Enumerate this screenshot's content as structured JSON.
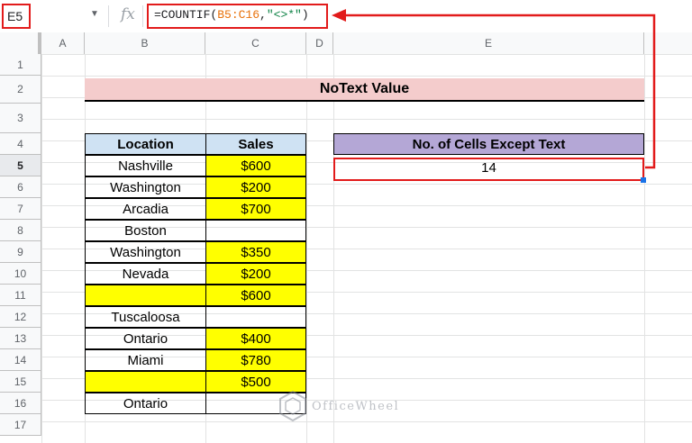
{
  "formula_bar": {
    "name_box": "E5",
    "fx": "fx",
    "formula_prefix": "=COUNTIF(",
    "formula_range": "B5:C16",
    "formula_sep": ",",
    "formula_criteria": "\"<>*\"",
    "formula_suffix": ")"
  },
  "columns": [
    "A",
    "B",
    "C",
    "D",
    "E"
  ],
  "rows": [
    "1",
    "2",
    "3",
    "4",
    "5",
    "6",
    "7",
    "8",
    "9",
    "10",
    "11",
    "12",
    "13",
    "14",
    "15",
    "16",
    "17"
  ],
  "selected_row": "5",
  "sheet": {
    "title": "NoText Value",
    "table": {
      "headers": [
        "Location",
        "Sales"
      ],
      "rows": [
        {
          "location": "Nashville",
          "sales": "$600"
        },
        {
          "location": "Washington",
          "sales": "$200"
        },
        {
          "location": "Arcadia",
          "sales": "$700"
        },
        {
          "location": "Boston",
          "sales": ""
        },
        {
          "location": "Washington",
          "sales": "$350"
        },
        {
          "location": "Nevada",
          "sales": "$200"
        },
        {
          "location": "",
          "sales": "$600"
        },
        {
          "location": "Tuscaloosa",
          "sales": ""
        },
        {
          "location": "Ontario",
          "sales": "$400"
        },
        {
          "location": "Miami",
          "sales": "$780"
        },
        {
          "location": "",
          "sales": "$500"
        },
        {
          "location": "Ontario",
          "sales": ""
        }
      ]
    },
    "result": {
      "header": "No. of Cells Except Text",
      "value": "14"
    }
  },
  "watermark": "OfficeWheel",
  "colors": {
    "title_fill": "#f4cccc",
    "header_blue": "#cfe2f3",
    "header_purple": "#b4a7d6",
    "highlight_yellow": "#ffff00",
    "annotation_red": "#e21b1b"
  }
}
